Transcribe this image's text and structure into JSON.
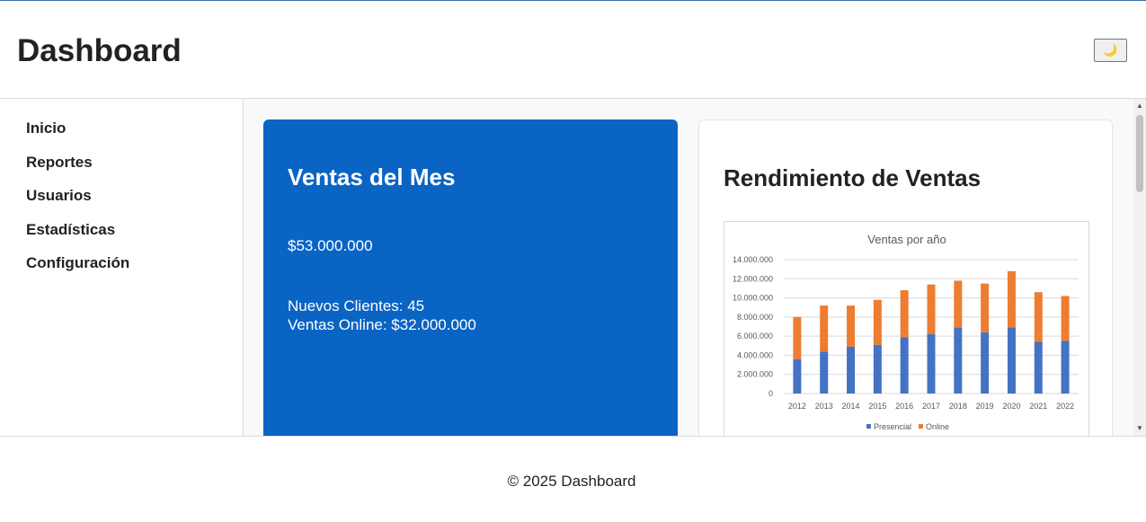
{
  "header": {
    "title": "Dashboard",
    "theme_toggle_icon": "🌙"
  },
  "sidebar": {
    "items": [
      {
        "label": "Inicio"
      },
      {
        "label": "Reportes"
      },
      {
        "label": "Usuarios"
      },
      {
        "label": "Estadísticas"
      },
      {
        "label": "Configuración"
      }
    ]
  },
  "cards": {
    "sales": {
      "title": "Ventas del Mes",
      "amount": "$53.000.000",
      "new_clients": "Nuevos Clientes: 45",
      "online_sales": "Ventas Online: $32.000.000"
    },
    "performance": {
      "title": "Rendimiento de Ventas"
    }
  },
  "chart_data": {
    "type": "bar",
    "stacked": true,
    "title": "Ventas por año",
    "xlabel": "",
    "ylabel": "",
    "categories": [
      "2012",
      "2013",
      "2014",
      "2015",
      "2016",
      "2017",
      "2018",
      "2019",
      "2020",
      "2021",
      "2022"
    ],
    "series": [
      {
        "name": "Presencial",
        "color": "#4472c4",
        "values": [
          3600000,
          4400000,
          4900000,
          5100000,
          5900000,
          6200000,
          6900000,
          6400000,
          6900000,
          5400000,
          5500000
        ]
      },
      {
        "name": "Online",
        "color": "#ed7d31",
        "values": [
          4400000,
          4800000,
          4300000,
          4700000,
          4900000,
          5200000,
          4900000,
          5100000,
          5900000,
          5200000,
          4700000
        ]
      }
    ],
    "ylim": [
      0,
      14000000
    ],
    "yticks": [
      "0",
      "2.000.000",
      "4.000.000",
      "6.000.000",
      "8.000.000",
      "10.000.000",
      "12.000.000",
      "14.000.000"
    ],
    "grid": true,
    "legend_position": "bottom"
  },
  "footer": {
    "text": "© 2025 Dashboard"
  },
  "colors": {
    "card_blue": "#0a64c4",
    "presencial": "#4472c4",
    "online": "#ed7d31"
  }
}
